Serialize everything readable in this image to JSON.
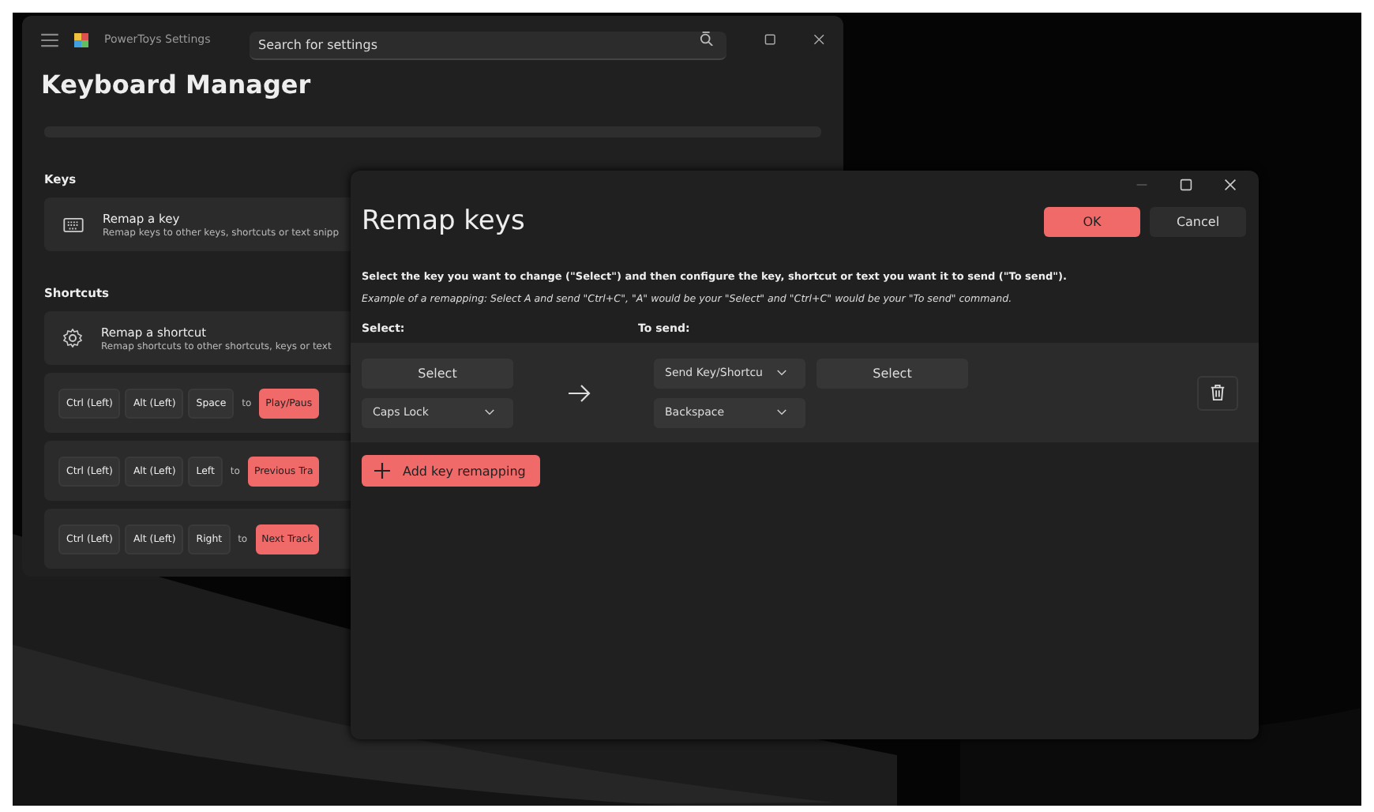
{
  "back_window": {
    "title": "PowerToys Settings",
    "search": {
      "placeholder": "Search for settings"
    },
    "heading": "Keyboard Manager",
    "sections": [
      {
        "header": "Keys",
        "cards": [
          {
            "title": "Remap a key",
            "description": "Remap keys to other keys, shortcuts or text snipp"
          }
        ]
      },
      {
        "header": "Shortcuts",
        "cards": [
          {
            "title": "Remap a shortcut",
            "description": "Remap shortcuts to other shortcuts, keys or text"
          }
        ]
      }
    ],
    "shortcuts": [
      {
        "keys": [
          "Ctrl (Left)",
          "Alt (Left)",
          "Space"
        ],
        "joiner": "to",
        "target": "Play/Paus"
      },
      {
        "keys": [
          "Ctrl (Left)",
          "Alt (Left)",
          "Left"
        ],
        "joiner": "to",
        "target": "Previous Tra"
      },
      {
        "keys": [
          "Ctrl (Left)",
          "Alt (Left)",
          "Right"
        ],
        "joiner": "to",
        "target": "Next Track"
      }
    ]
  },
  "dialog": {
    "title": "Remap keys",
    "ok": "OK",
    "cancel": "Cancel",
    "instruction": "Select the key you want to change (\"Select\") and then configure the key, shortcut or text you want it to send (\"To send\").",
    "example": "Example of a remapping: Select A and send \"Ctrl+C\", \"A\" would be your \"Select\" and \"Ctrl+C\" would be your \"To send\" command.",
    "select_header": "Select:",
    "send_header": "To send:",
    "rows": [
      {
        "select_button": "Select",
        "key": "Caps Lock",
        "send_type": "Send Key/Shortcu",
        "send_select_button": "Select",
        "send_key": "Backspace"
      }
    ],
    "add_button": "Add key remapping"
  }
}
